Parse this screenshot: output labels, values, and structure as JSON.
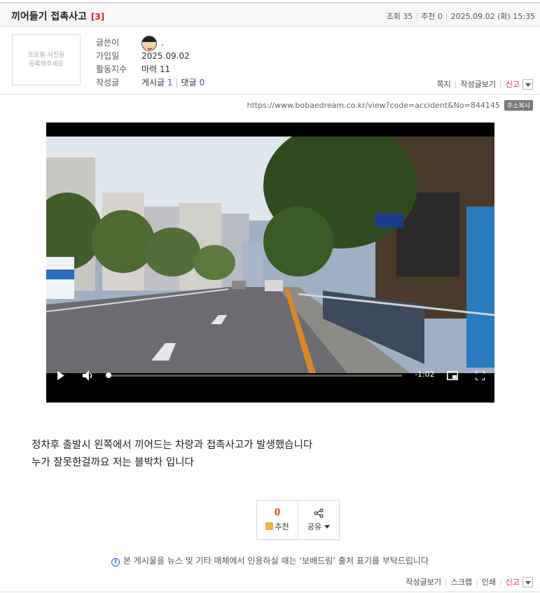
{
  "post": {
    "title": "끼어들기 접촉사고",
    "comment_count": "[3]",
    "views_label": "조회 35",
    "recommend_label": "추천 0",
    "datetime": "2025.09.02 (화) 15:35"
  },
  "author": {
    "profile_placeholder_line1": "프로필 사진을",
    "profile_placeholder_line2": "등록해주세요",
    "labels": [
      "글쓴이",
      "가입일",
      "활동지수",
      "작성글"
    ],
    "nickname": ".",
    "join_date": "2025.09.02",
    "activity": "마력 11",
    "posts_label": "게시글",
    "posts_count": "1",
    "comments_label": "댓글",
    "comments_count": "0",
    "links": {
      "message": "쪽지",
      "view_posts": "작성글보기",
      "report": "신고"
    }
  },
  "url_bar": {
    "url": "https://www.bobaedream.co.kr/view?code=accident&No=844145",
    "copy_label": "주소복사"
  },
  "video": {
    "duration_remaining": "-1:02",
    "progress": 0.0
  },
  "content": {
    "line1": "정차후 출발시 왼쪽에서 끼어드는 차랑과 접촉사고가 발생했습니다",
    "line2": "누가 잘못한걸까요 저는 블박차 입니다"
  },
  "actions": {
    "recommend_count": "0",
    "recommend_label": "추천",
    "share_label": "공유"
  },
  "notice": "본 게시물을 뉴스 및 기타 매체에서 인용하실 때는 ‘보배드림’ 출처 표기를 부탁드립니다",
  "bottom_links": {
    "view_posts": "작성글보기",
    "scrap": "스크랩",
    "print": "인쇄",
    "report": "신고"
  }
}
